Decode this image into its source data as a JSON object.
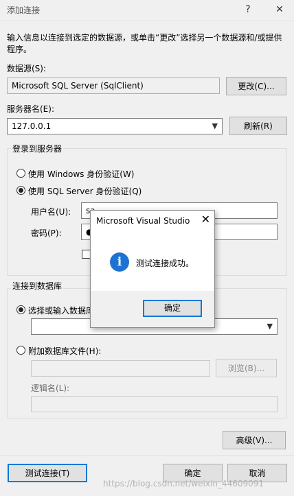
{
  "window": {
    "title": "添加连接",
    "help_glyph": "?",
    "close_glyph": "✕"
  },
  "intro": {
    "line1": "输入信息以连接到选定的数据源，或单击“更改”选择另一个数据源和/或提供",
    "line2": "程序。"
  },
  "datasource": {
    "label": "数据源(S):",
    "value": "Microsoft SQL Server (SqlClient)",
    "change_button": "更改(C)..."
  },
  "server": {
    "label": "服务器名(E):",
    "value": "127.0.0.1",
    "refresh_button": "刷新(R)"
  },
  "login": {
    "group_label": "登录到服务器",
    "windows_auth": "使用 Windows 身份验证(W)",
    "sql_auth": "使用 SQL Server 身份验证(Q)",
    "username_label": "用户名(U):",
    "username_value": "sa",
    "password_label": "密码(P):",
    "password_value": "●"
  },
  "database": {
    "group_label": "连接到数据库",
    "select_option": "选择或输入数据库",
    "attach_option": "附加数据库文件(H):",
    "browse_button": "浏览(B)...",
    "logical_name_label": "逻辑名(L):"
  },
  "advanced_button": "高级(V)...",
  "footer": {
    "test_button": "测试连接(T)",
    "ok_button": "确定",
    "cancel_button": "取消"
  },
  "modal": {
    "title": "Microsoft Visual Studio",
    "close_glyph": "✕",
    "message": "测试连接成功。",
    "icon_glyph": "i",
    "ok_button": "确定"
  },
  "watermark": "https://blog.csdn.net/weixin_44609091",
  "colors": {
    "accent": "#0078d7",
    "info_icon": "#1e73d2"
  }
}
